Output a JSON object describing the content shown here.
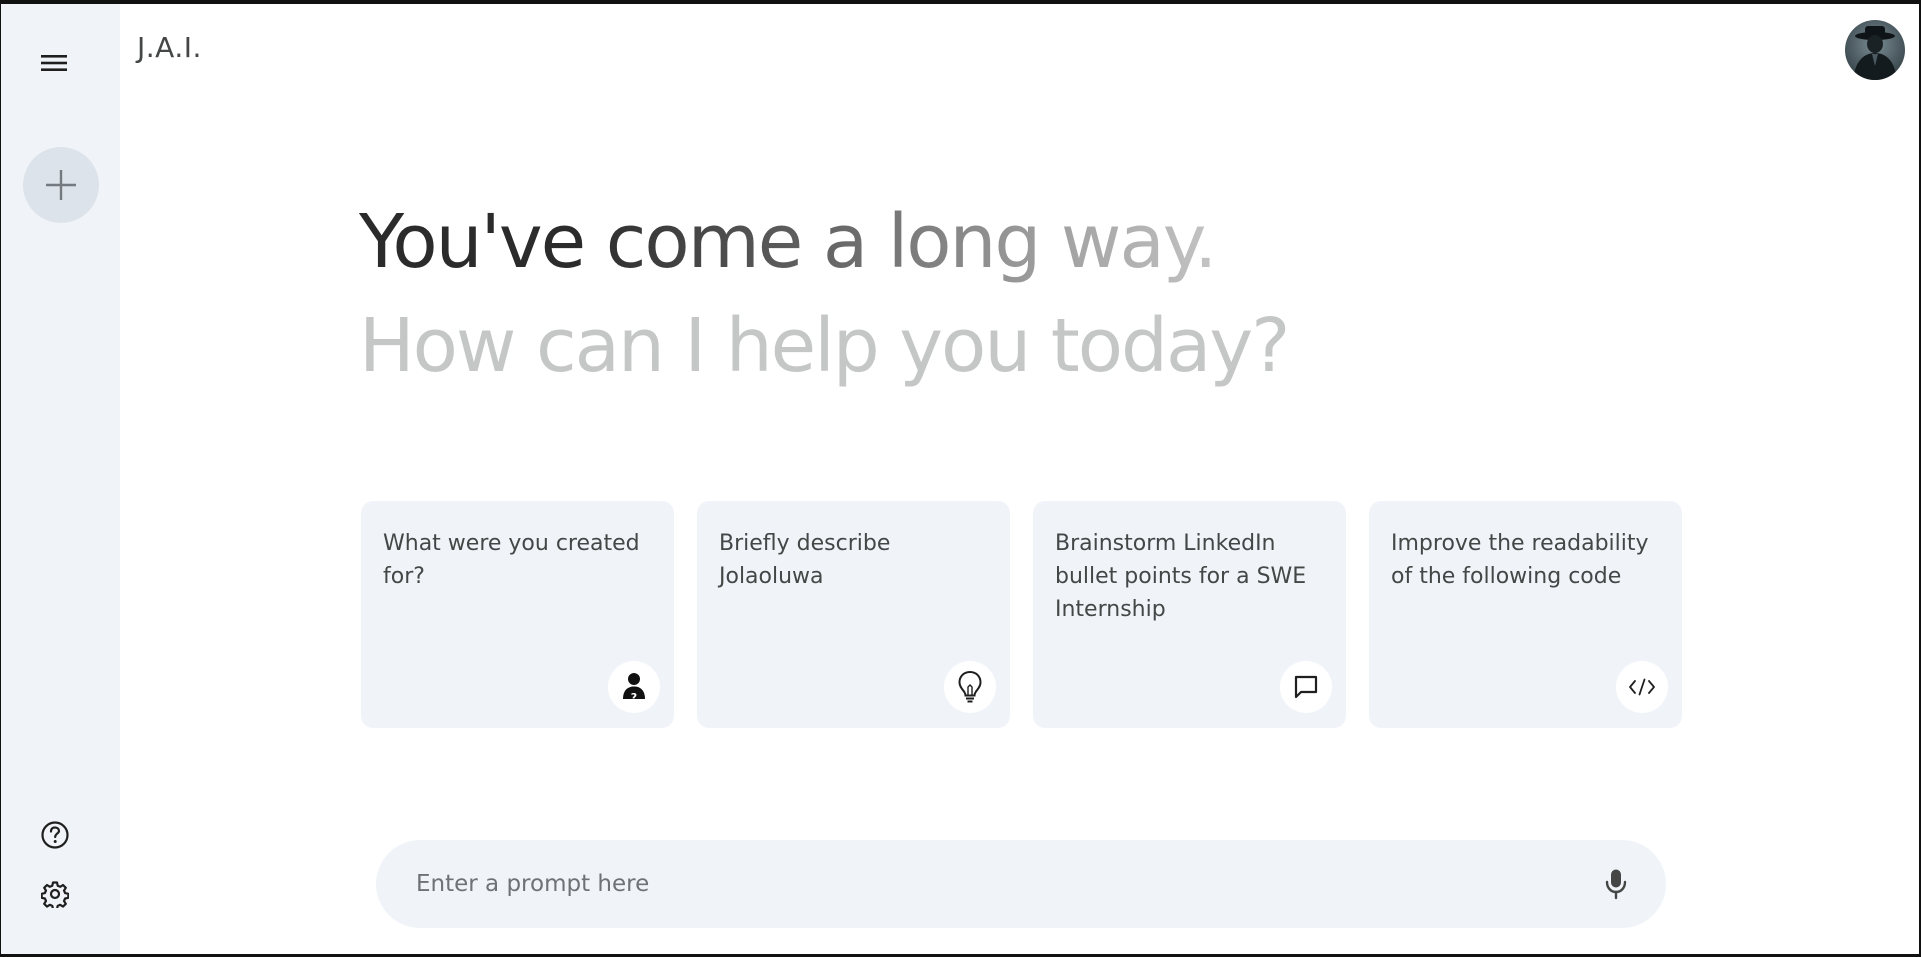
{
  "header": {
    "app_title": "J.A.I.",
    "avatar_alt": "user-avatar"
  },
  "sidebar": {
    "menu_icon": "hamburger-menu-icon",
    "new_chat_icon": "plus-icon",
    "help_icon": "help-circle-icon",
    "settings_icon": "gear-icon"
  },
  "greeting": {
    "line1": "You've come a long way.",
    "line2": "How can I help you today?"
  },
  "cards": [
    {
      "text": "What were you created for?",
      "icon": "person-question-icon"
    },
    {
      "text": "Briefly describe Jolaoluwa",
      "icon": "lightbulb-icon"
    },
    {
      "text": "Brainstorm LinkedIn bullet points for a SWE Internship",
      "icon": "chat-bubble-icon"
    },
    {
      "text": "Improve the readability of the following code",
      "icon": "code-icon"
    }
  ],
  "prompt": {
    "placeholder": "Enter a prompt here",
    "value": "",
    "mic_icon": "microphone-icon"
  },
  "colors": {
    "sidebar_bg": "#f0f4f9",
    "card_bg": "#f0f4f9",
    "text_primary": "#444746",
    "greeting_muted": "#c4c7c5"
  }
}
